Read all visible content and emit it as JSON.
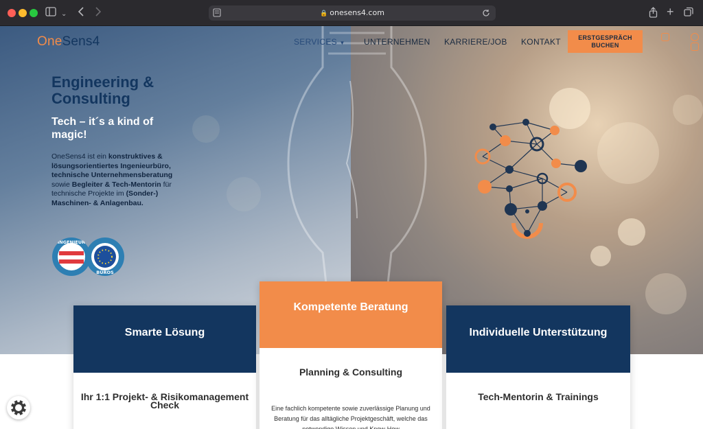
{
  "browser": {
    "url": "onesens4.com"
  },
  "logo": {
    "prefix": "One",
    "suffix": "Sens4"
  },
  "nav": {
    "services": "SERVICES",
    "company": "UNTERNEHMEN",
    "career": "KARRIERE/JOB",
    "contact": "KONTAKT",
    "cta_line1": "ERSTGESPRÄCH",
    "cta_line2": "BUCHEN"
  },
  "hero": {
    "title": "Engineering & Consulting",
    "subtitle": "Tech – it´s a kind of magic!",
    "body_1": "OneSens4 ist ein ",
    "body_2": "konstruktives & lösungsorientiertes Ingenieurbüro, technische Unternehmensberatung",
    "body_3": " sowie ",
    "body_4": "Begleiter & Tech-Mentorin",
    "body_5": " für technische Projekte im ",
    "body_6": "(Sonder-) Maschinen- & Anlagenbau.",
    "seal_text_top": "INGENIEUR",
    "seal_text_bottom": "BÜROS"
  },
  "cards": [
    {
      "head": "Smarte Lösung",
      "title": "Ihr 1:1 Projekt- & Risikomanagement Check",
      "text": ""
    },
    {
      "head": "Kompetente Beratung",
      "title": "Planning & Consulting",
      "text": "Eine fachlich kompetente sowie zuverlässige Planung und Beratung für das alltägliche Projektgeschäft, welche das notwendige Wissen und Know-How"
    },
    {
      "head": "Individuelle Unterstützung",
      "title": "Tech-Mentorin & Trainings",
      "text": ""
    }
  ],
  "colors": {
    "navy": "#13365f",
    "orange": "#f28c4a",
    "white": "#ffffff"
  }
}
